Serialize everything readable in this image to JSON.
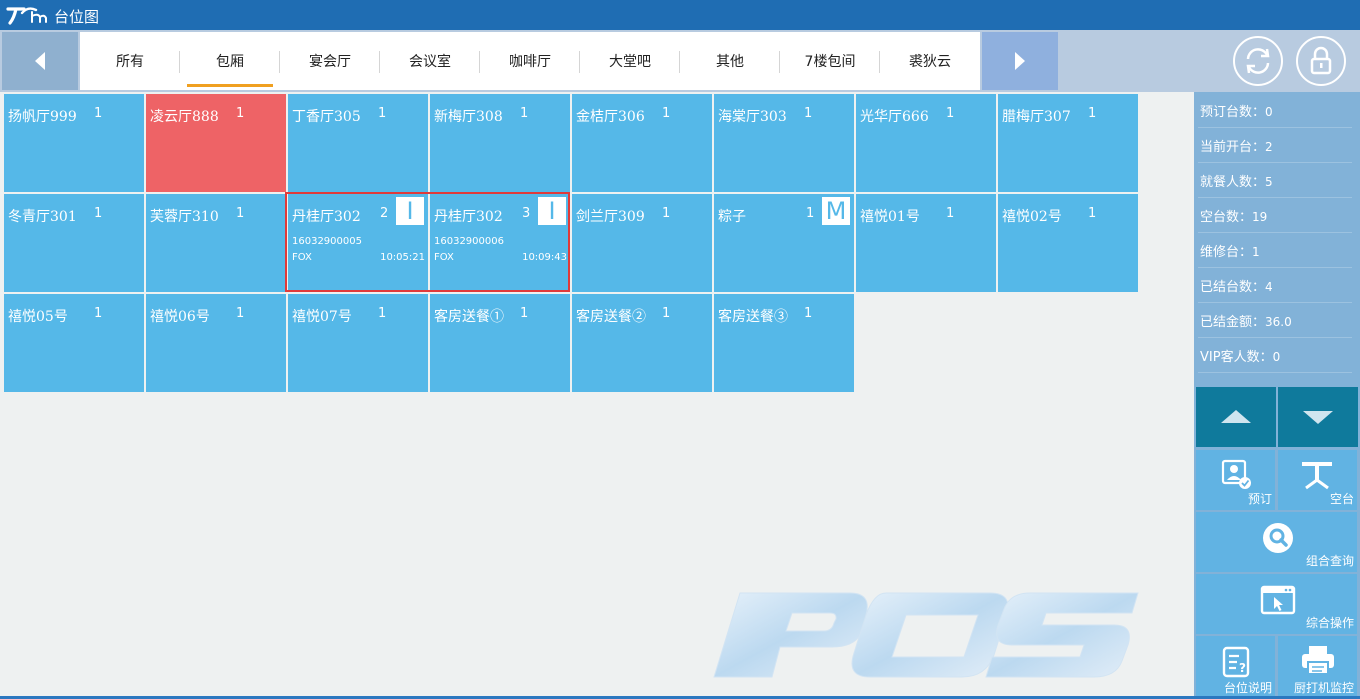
{
  "window": {
    "title": "台位图"
  },
  "tabs": [
    {
      "label": "所有",
      "active": false
    },
    {
      "label": "包厢",
      "active": true
    },
    {
      "label": "宴会厅",
      "active": false
    },
    {
      "label": "会议室",
      "active": false
    },
    {
      "label": "咖啡厅",
      "active": false
    },
    {
      "label": "大堂吧",
      "active": false
    },
    {
      "label": "其他",
      "active": false
    },
    {
      "label": "7楼包间",
      "active": false
    },
    {
      "label": "裘狄云",
      "active": false
    }
  ],
  "tables": [
    {
      "name": "扬帆厅999",
      "count": "1",
      "status": "free"
    },
    {
      "name": "凌云厅888",
      "count": "1",
      "status": "maintenance"
    },
    {
      "name": "丁香厅305",
      "count": "1",
      "status": "free"
    },
    {
      "name": "新梅厅308",
      "count": "1",
      "status": "free"
    },
    {
      "name": "金桔厅306",
      "count": "1",
      "status": "free"
    },
    {
      "name": "海棠厅303",
      "count": "1",
      "status": "free"
    },
    {
      "name": "光华厅666",
      "count": "1",
      "status": "free"
    },
    {
      "name": "腊梅厅307",
      "count": "1",
      "status": "free"
    },
    {
      "name": "冬青厅301",
      "count": "1",
      "status": "free"
    },
    {
      "name": "芙蓉厅310",
      "count": "1",
      "status": "free"
    },
    {
      "name": "丹桂厅302",
      "count": "2",
      "status": "open",
      "badge": "I",
      "bill": "16032900005",
      "user": "FOX",
      "time": "10:05:21"
    },
    {
      "name": "丹桂厅302",
      "count": "3",
      "status": "open",
      "badge": "I",
      "bill": "16032900006",
      "user": "FOX",
      "time": "10:09:43"
    },
    {
      "name": "剑兰厅309",
      "count": "1",
      "status": "free"
    },
    {
      "name": "粽子",
      "count": "1",
      "status": "free",
      "badge": "M"
    },
    {
      "name": "禧悦01号",
      "count": "1",
      "status": "free"
    },
    {
      "name": "禧悦02号",
      "count": "1",
      "status": "free"
    },
    {
      "name": "禧悦05号",
      "count": "1",
      "status": "free"
    },
    {
      "name": "禧悦06号",
      "count": "1",
      "status": "free"
    },
    {
      "name": "禧悦07号",
      "count": "1",
      "status": "free"
    },
    {
      "name": "客房送餐①",
      "count": "1",
      "status": "free"
    },
    {
      "name": "客房送餐②",
      "count": "1",
      "status": "free"
    },
    {
      "name": "客房送餐③",
      "count": "1",
      "status": "free"
    }
  ],
  "stats": [
    {
      "label": "预订台数：",
      "value": "0"
    },
    {
      "label": "当前开台：",
      "value": "2"
    },
    {
      "label": "就餐人数：",
      "value": "5"
    },
    {
      "label": "空台数：",
      "value": "19"
    },
    {
      "label": "维修台：",
      "value": "1"
    },
    {
      "label": "已结台数：",
      "value": "4"
    },
    {
      "label": "已结金额：",
      "value": "36.0"
    },
    {
      "label": "VIP客人数：",
      "value": "0"
    }
  ],
  "actions": {
    "reserve": "预订",
    "free_table": "空台",
    "combined_query": "组合查询",
    "general_ops": "综合操作",
    "table_notes": "台位说明",
    "printer_monitor": "厨打机监控"
  },
  "icons": {
    "prev": "chevron-left-icon",
    "next": "chevron-right-icon",
    "refresh": "refresh-icon",
    "lock": "lock-icon",
    "scroll_up": "triangle-up-icon",
    "scroll_down": "triangle-down-icon"
  },
  "colors": {
    "title_bar": "#1f6db3",
    "table_free": "#55b8e8",
    "table_maintenance": "#ee6366",
    "selection": "#e03a3a",
    "active_tab": "#f0a020",
    "arrow_btn": "#0f7a9c"
  }
}
